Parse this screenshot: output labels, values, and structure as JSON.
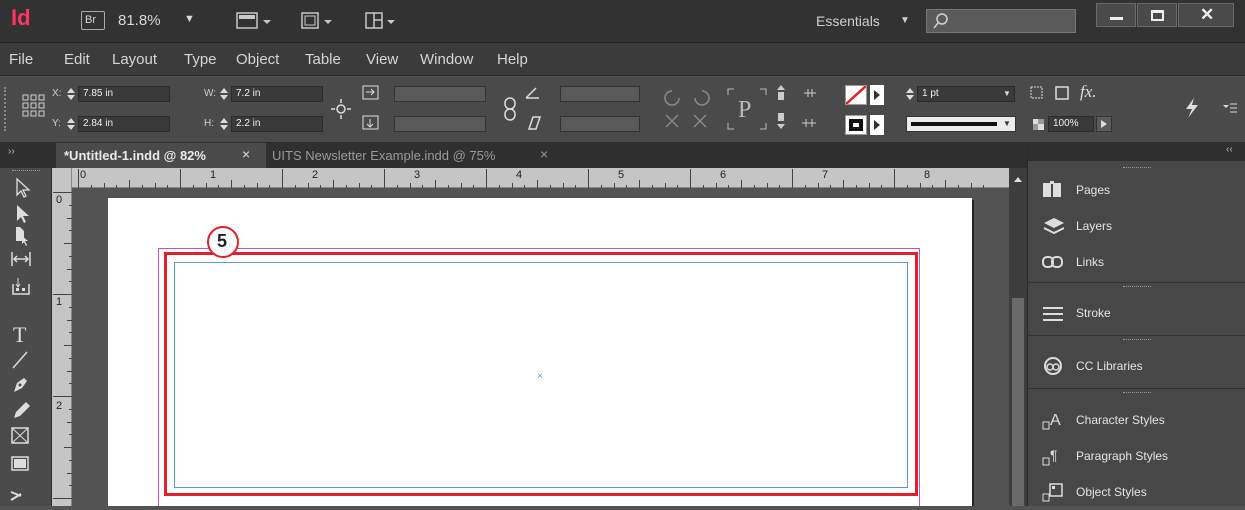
{
  "appbar": {
    "logo": "Id",
    "bridge": "Br",
    "zoom": "81.8%",
    "workspace": "Essentials",
    "search_placeholder": ""
  },
  "menu": [
    "File",
    "Edit",
    "Layout",
    "Type",
    "Object",
    "Table",
    "View",
    "Window",
    "Help"
  ],
  "control": {
    "x_label": "X:",
    "x_value": "7.85 in",
    "y_label": "Y:",
    "y_value": "2.84 in",
    "w_label": "W:",
    "w_value": "7.2 in",
    "h_label": "H:",
    "h_value": "2.2 in",
    "stroke_weight": "1 pt",
    "opacity": "100%",
    "fx": "fx."
  },
  "tabs": [
    {
      "label": "*Untitled-1.indd @ 82%",
      "active": true,
      "close": "×"
    },
    {
      "label": "UITS Newsletter Example.indd @ 75%",
      "active": false,
      "close": "×"
    }
  ],
  "ruler": {
    "h": [
      "0",
      "1",
      "2",
      "3",
      "4",
      "5",
      "6",
      "7",
      "8"
    ],
    "v": [
      "0",
      "1",
      "2"
    ]
  },
  "annotation": {
    "step": "5"
  },
  "panels": [
    {
      "label": "Pages",
      "icon": "pages-icon"
    },
    {
      "label": "Layers",
      "icon": "layers-icon"
    },
    {
      "label": "Links",
      "icon": "links-icon"
    },
    {
      "label": "Stroke",
      "icon": "stroke-icon"
    },
    {
      "label": "CC Libraries",
      "icon": "cc-libraries-icon"
    },
    {
      "label": "Character Styles",
      "icon": "character-styles-icon"
    },
    {
      "label": "Paragraph Styles",
      "icon": "paragraph-styles-icon"
    },
    {
      "label": "Object Styles",
      "icon": "object-styles-icon"
    }
  ],
  "colors": {
    "app_logo": "#ff3366",
    "annotation": "#e0202a",
    "frame": "#5b9bd5",
    "margin": "#c850c8"
  }
}
